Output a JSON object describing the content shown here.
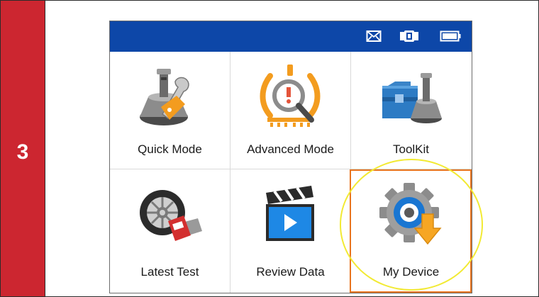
{
  "step": {
    "number": "3"
  },
  "status_bar": {
    "icons": [
      "mail-icon",
      "vehicle-link-icon",
      "battery-icon"
    ],
    "color": "#0d47a8"
  },
  "menu": {
    "items": [
      {
        "label": "Quick Mode",
        "icon": "tpms-sensor-wrench-icon",
        "selected": false
      },
      {
        "label": "Advanced Mode",
        "icon": "tpms-warning-magnifier-icon",
        "selected": false
      },
      {
        "label": "ToolKit",
        "icon": "toolbox-sensor-icon",
        "selected": false
      },
      {
        "label": "Latest Test",
        "icon": "tire-tool-icon",
        "selected": false
      },
      {
        "label": "Review Data",
        "icon": "clapperboard-play-icon",
        "selected": false
      },
      {
        "label": "My Device",
        "icon": "gear-download-icon",
        "selected": true
      }
    ]
  },
  "colors": {
    "step_bar": "#cc2630",
    "selection_border": "#e8741e",
    "highlight_circle": "#f2ea33"
  }
}
